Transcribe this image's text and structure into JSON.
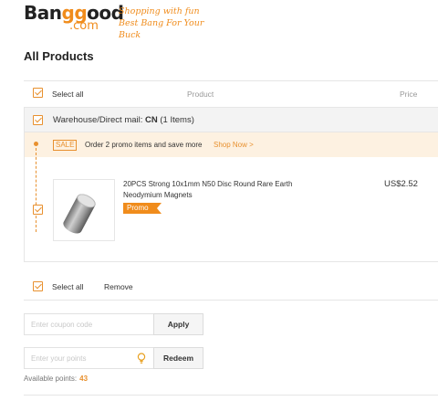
{
  "brand": {
    "name_prefix": "Ban",
    "name_g1": "g",
    "name_g2": "g",
    "name_suffix": "ood",
    "domain": ".com",
    "tagline_1": "Shopping with fun",
    "tagline_2": "Best Bang For Your Buck",
    "accent_color": "#f08c1c"
  },
  "page": {
    "title": "All Products"
  },
  "header": {
    "select_all_label": "Select all",
    "product_col": "Product",
    "price_col": "Price",
    "select_all_checked": true
  },
  "warehouse": {
    "label_prefix": "Warehouse/Direct mail: ",
    "code": "CN",
    "count_text": " (1 Items)",
    "checked": true
  },
  "promo": {
    "badge": "SALE",
    "text": "Order 2 promo items and save more",
    "link": "Shop Now >"
  },
  "items": [
    {
      "title": "20PCS Strong 10x1mm N50 Disc Round Rare Earth Neodymium Magnets",
      "tag": "Promo",
      "price": "US$2.52",
      "checked": true,
      "image": "cylinder-magnet"
    }
  ],
  "footer": {
    "select_all_label": "Select all",
    "remove_label": "Remove",
    "select_all_checked": true
  },
  "coupon": {
    "placeholder": "Enter coupon code",
    "apply_label": "Apply"
  },
  "points": {
    "placeholder": "Enter your points",
    "redeem_label": "Redeem",
    "available_label": "Available points:",
    "available_value": "43",
    "icon": "lightbulb-icon"
  }
}
